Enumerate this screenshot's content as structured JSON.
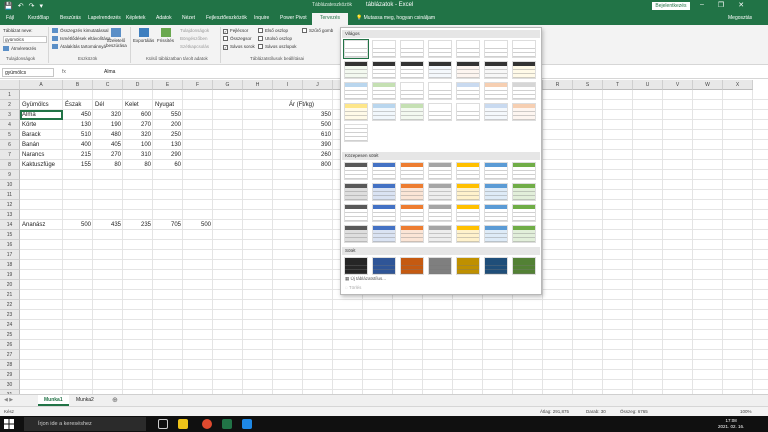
{
  "titlebar": {
    "autosave_icon": "save-icon",
    "context_label": "Táblázateszközök",
    "document_title": "táblázatok - Excel",
    "signin_label": "Bejelentkezés",
    "window_controls": [
      "–",
      "❐",
      "✕"
    ]
  },
  "tabs": [
    {
      "label": "Fájl"
    },
    {
      "label": "Kezdőlap"
    },
    {
      "label": "Beszúrás"
    },
    {
      "label": "Lapelrendezés"
    },
    {
      "label": "Képletek"
    },
    {
      "label": "Adatok"
    },
    {
      "label": "Nézet"
    },
    {
      "label": "Fejlesztőeszközök"
    },
    {
      "label": "Inquire"
    },
    {
      "label": "Power Pivot"
    },
    {
      "label": "Tervezés"
    }
  ],
  "tell_me": "Mutassa meg, hogyan csináljam",
  "share_label": "Megosztás",
  "ribbon": {
    "table_name_label": "Táblázat neve:",
    "table_name_value": "gyümölcs",
    "resize_label": "Átméretezés",
    "group_properties": "Tulajdonságok",
    "pivot_summary": "Összegzés kimutatással",
    "remove_duplicates": "Ismétlődések eltávolítása",
    "convert_to_range": "Átalakítás tartománnyá",
    "slicer_label": "Szeletelő beszúrása",
    "group_tools": "Eszközök",
    "export_label": "Exportálás",
    "refresh_label": "Frissítés",
    "properties_label": "Tulajdonságok",
    "open_browser_label": "Böngészőben",
    "unlink_label": "Szétkapcsolás",
    "group_external": "Külső táblázatban tárolt adatok",
    "opt_header_row": "Fejlécsor",
    "opt_total_row": "Összegsor",
    "opt_banded_rows": "Sávos sorok",
    "opt_first_column": "Első oszlop",
    "opt_last_column": "Utolsó oszlop",
    "opt_banded_columns": "Sávos oszlopok",
    "opt_filter_button": "Szűrő gomb",
    "group_style_options": "Táblázatstílusok beállításai"
  },
  "namebox": "gyümölcs",
  "fx_label": "fx",
  "formula": "Alma",
  "columns": [
    "A",
    "B",
    "C",
    "D",
    "E",
    "F",
    "G",
    "H",
    "I",
    "J",
    "K",
    "L",
    "M",
    "N",
    "O",
    "P",
    "Q",
    "R",
    "S",
    "T",
    "U",
    "V",
    "W",
    "X"
  ],
  "rows": [
    "1",
    "2",
    "3",
    "4",
    "5",
    "6",
    "7",
    "8",
    "9",
    "10",
    "11",
    "12",
    "13",
    "14",
    "15",
    "16",
    "17",
    "18",
    "19",
    "20",
    "21",
    "22",
    "23",
    "24",
    "25",
    "26",
    "27",
    "28",
    "29",
    "30",
    "31"
  ],
  "table": {
    "headers": [
      "Gyümölcs",
      "Észak",
      "Dél",
      "Kelet",
      "Nyugat"
    ],
    "rows": [
      [
        "Alma",
        "450",
        "320",
        "600",
        "550"
      ],
      [
        "Körte",
        "130",
        "190",
        "270",
        "200"
      ],
      [
        "Barack",
        "510",
        "480",
        "320",
        "250"
      ],
      [
        "Banán",
        "400",
        "405",
        "100",
        "130"
      ],
      [
        "Narancs",
        "215",
        "270",
        "310",
        "290"
      ],
      [
        "Kaktuszfüge",
        "155",
        "80",
        "80",
        "60"
      ]
    ]
  },
  "price": {
    "header": "Ár (Ft/kg)",
    "values": [
      "350",
      "500",
      "610",
      "390",
      "260",
      "800"
    ]
  },
  "row14": [
    "Ananász",
    "500",
    "435",
    "235",
    "705",
    "500"
  ],
  "gallery": {
    "light_label": "Világos",
    "medium_label": "Közepesen sötét",
    "dark_label": "Sötét",
    "new_style": "Új táblázatstílus...",
    "clear": "Törlés"
  },
  "sheet_tabs": [
    "Munka1",
    "Munka2"
  ],
  "status": {
    "mode": "Kész",
    "average": "Átlag: 291,875",
    "count": "Darab: 30",
    "sum": "Összeg: 6765",
    "zoom": "100%"
  },
  "taskbar": {
    "search_placeholder": "Írjon ide a kereséshez",
    "time": "17:08",
    "date": "2021. 02. 16."
  },
  "colors": {
    "excel_green": "#217346",
    "light_swatches": [
      "#ffffff",
      "#ffffff",
      "#c9daf0",
      "#f6cfb2",
      "#d6d6d6",
      "#fde68a",
      "#b9d6ee",
      "#c5e0b3"
    ],
    "medium_swatches": [
      "#595959",
      "#4472c4",
      "#ed7d31",
      "#a5a5a5",
      "#ffc000",
      "#5b9bd5",
      "#70ad47"
    ],
    "dark_swatches": [
      "#262626",
      "#2f5597",
      "#c55a11",
      "#7f7f7f",
      "#bf9000",
      "#1f4e79",
      "#538135"
    ]
  }
}
